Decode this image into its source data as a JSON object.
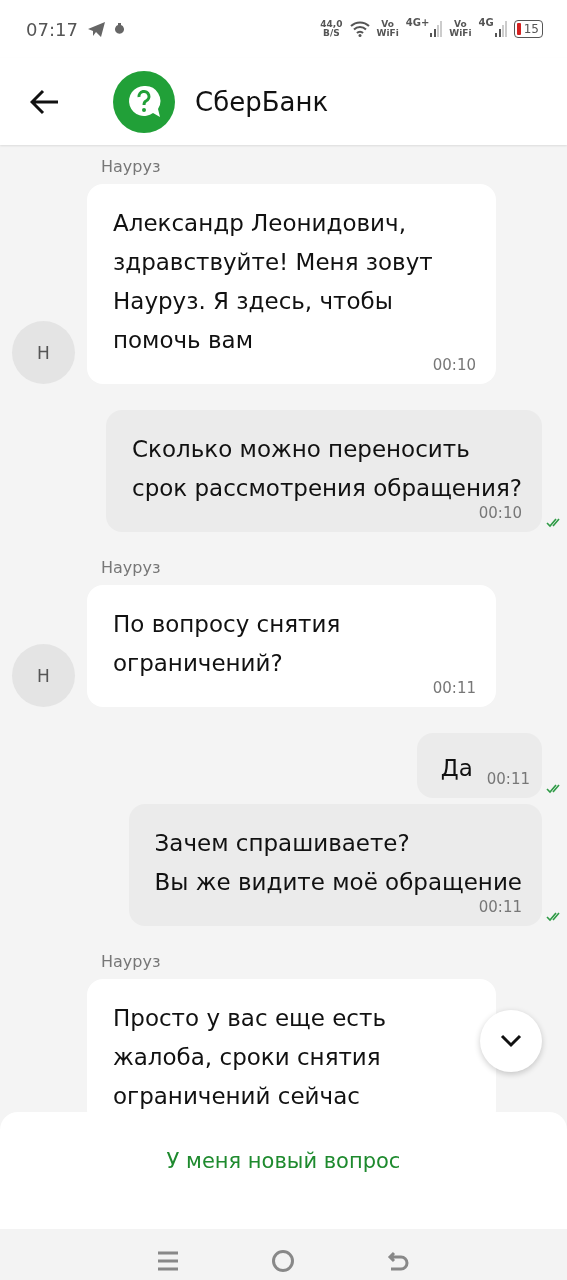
{
  "status_bar": {
    "time": "07:17",
    "speed_value": "44,0",
    "speed_unit": "B/S",
    "sim1_vowifi": [
      "Vo",
      "WiFi"
    ],
    "sim1_network": "4G+",
    "sim2_vowifi": [
      "Vo",
      "WiFi"
    ],
    "sim2_network": "4G",
    "battery": "15"
  },
  "header": {
    "title": "СберБанк"
  },
  "messages": [
    {
      "kind": "incoming",
      "sender": "Науруз",
      "avatar": "Н",
      "text": "Александр Леонидович,\nздравствуйте! Меня зовут\nНауруз. Я здесь, чтобы\nпомочь вам",
      "time": "00:10"
    },
    {
      "kind": "outgoing",
      "text": "Сколько можно переносить\nсрок рассмотрения обращения?",
      "time": "00:10",
      "read": true
    },
    {
      "kind": "incoming",
      "sender": "Науруз",
      "avatar": "Н",
      "text": "По вопросу снятия\nограничений?",
      "time": "00:11"
    },
    {
      "kind": "outgoing",
      "text": "Да",
      "time": "00:11",
      "read": true,
      "inline_time": true
    },
    {
      "kind": "outgoing",
      "text": "Зачем спрашиваете?\nВы же видите моё обращение",
      "time": "00:11",
      "read": true
    },
    {
      "kind": "incoming",
      "sender": "Науруз",
      "text": "Просто у вас еще есть\nжалоба, сроки снятия\nограничений сейчас"
    }
  ],
  "new_question_button": "У меня новый вопрос"
}
